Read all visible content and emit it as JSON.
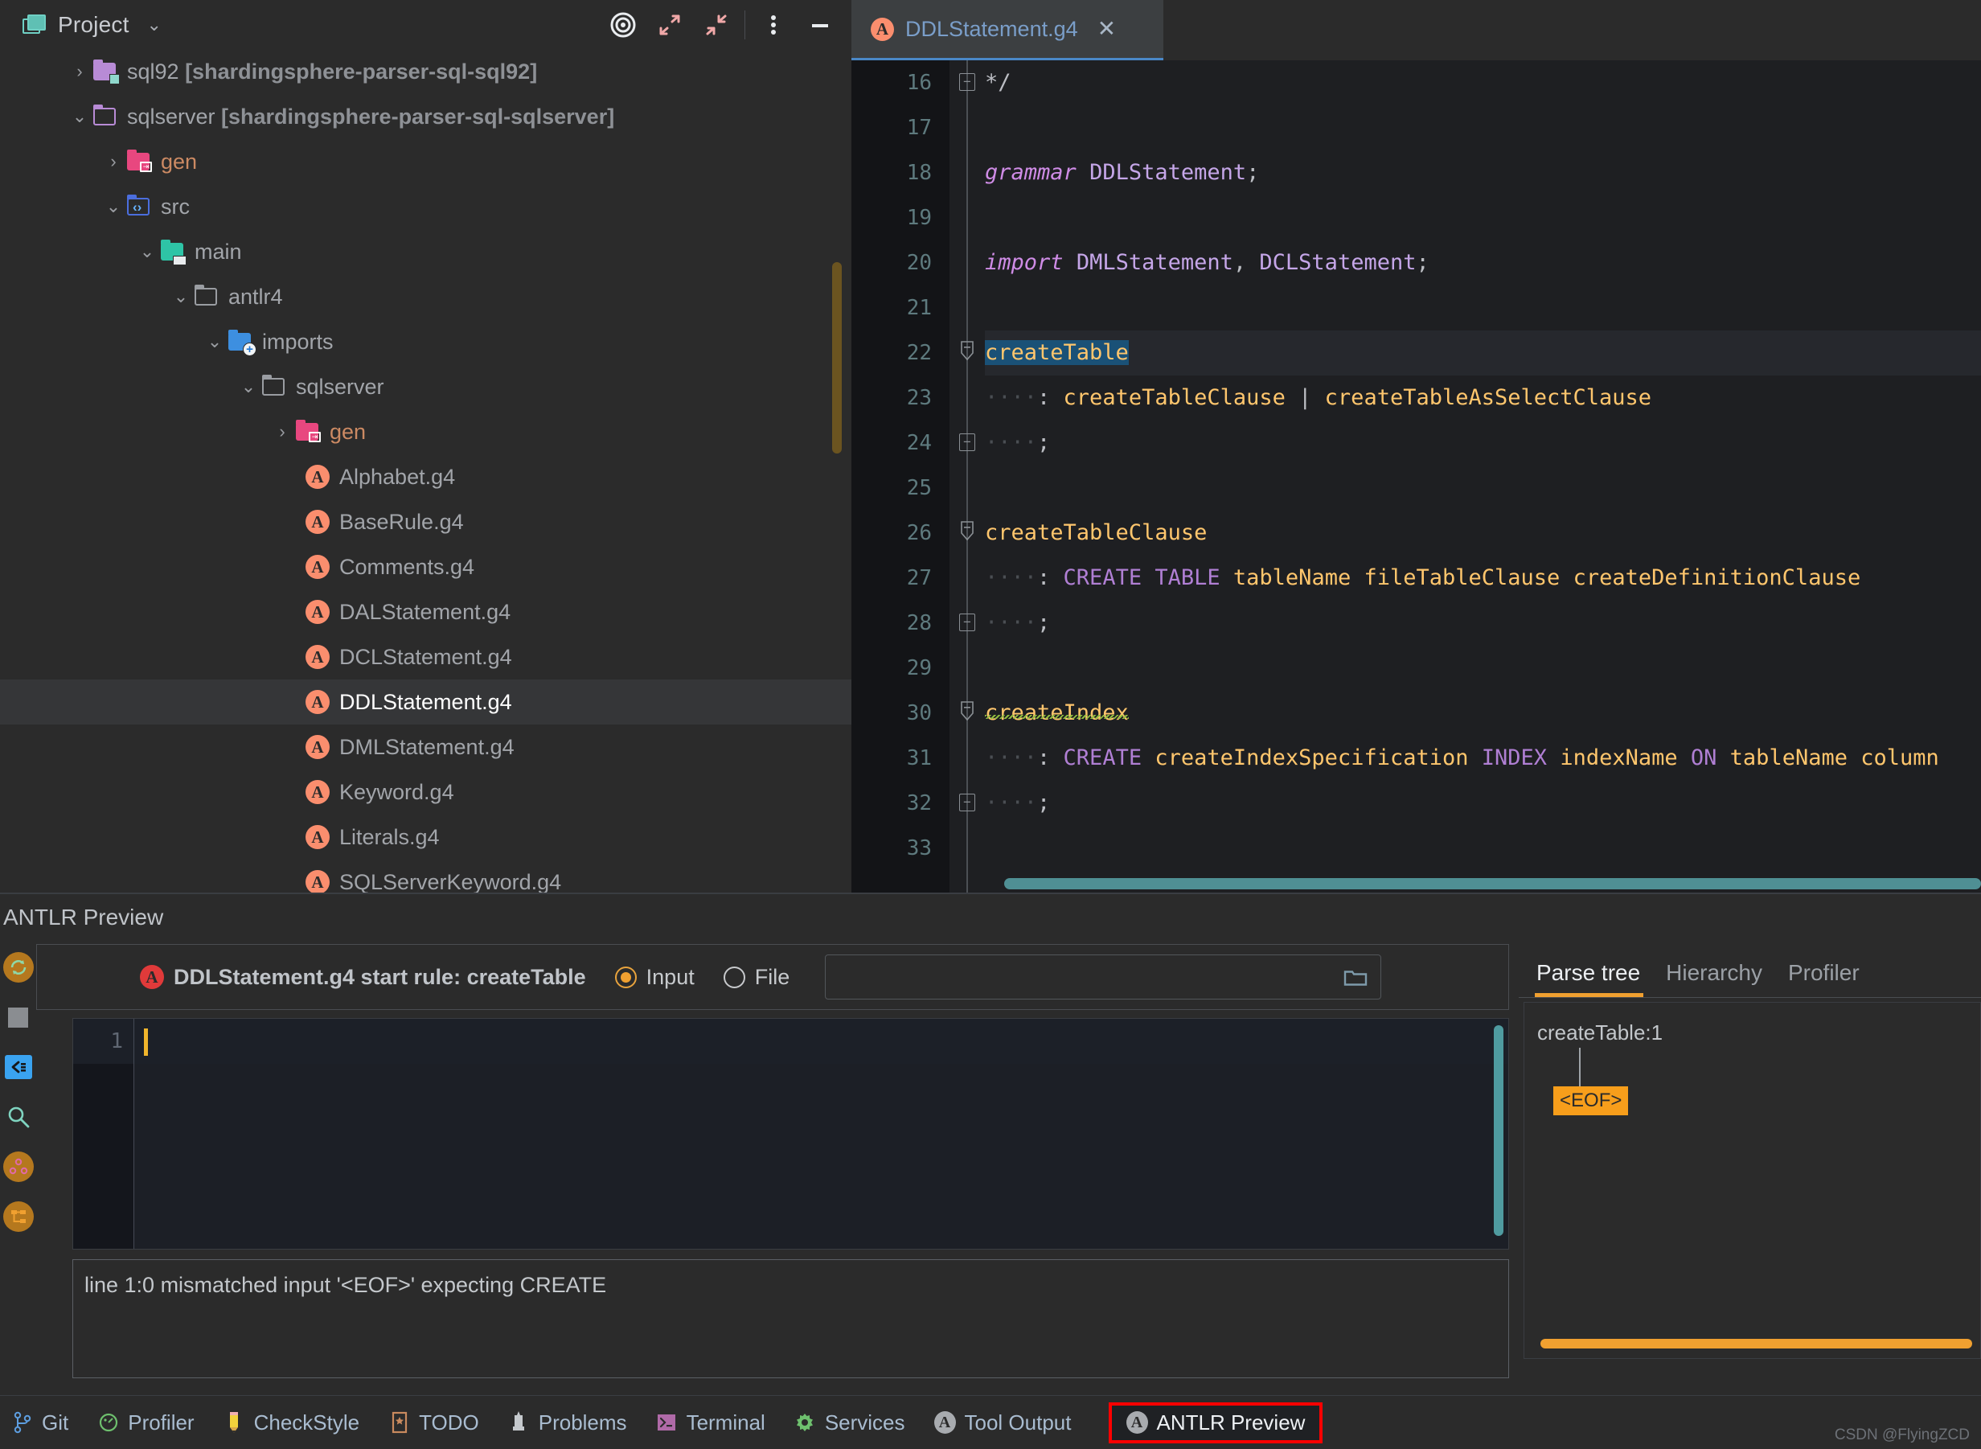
{
  "project": {
    "title": "Project",
    "chevron": "⌄",
    "toolbar": [
      {
        "name": "select-opened-file-icon",
        "glyph": "target"
      },
      {
        "name": "expand-all-icon",
        "glyph": "expand"
      },
      {
        "name": "collapse-all-icon",
        "glyph": "collapse"
      },
      {
        "name": "more-options-icon",
        "glyph": "dots"
      },
      {
        "name": "hide-panel-icon",
        "glyph": "minus"
      }
    ],
    "tree": [
      {
        "label": "sql92 ",
        "module": "[shardingsphere-parser-sql-sql92]",
        "arrow": "›",
        "indent": 84,
        "icon": "folder-purple-module",
        "selected": false
      },
      {
        "label": "sqlserver ",
        "module": "[shardingsphere-parser-sql-sqlserver]",
        "arrow": "⌄",
        "indent": 84,
        "icon": "folder-purple-outline",
        "selected": false
      },
      {
        "label": "gen",
        "module": "",
        "arrow": "›",
        "indent": 126,
        "icon": "folder-pink-gen",
        "selected": false
      },
      {
        "label": "src",
        "module": "",
        "arrow": "⌄",
        "indent": 126,
        "icon": "folder-src",
        "selected": false
      },
      {
        "label": "main",
        "module": "",
        "arrow": "⌄",
        "indent": 168,
        "icon": "folder-main",
        "selected": false
      },
      {
        "label": "antlr4",
        "module": "",
        "arrow": "⌄",
        "indent": 210,
        "icon": "folder-gray",
        "selected": false
      },
      {
        "label": "imports",
        "module": "",
        "arrow": "⌄",
        "indent": 252,
        "icon": "folder-imports",
        "selected": false
      },
      {
        "label": "sqlserver",
        "module": "",
        "arrow": "⌄",
        "indent": 294,
        "icon": "folder-gray",
        "selected": false
      },
      {
        "label": "gen",
        "module": "",
        "arrow": "›",
        "indent": 336,
        "icon": "folder-pink-gen",
        "selected": false
      },
      {
        "label": "Alphabet.g4",
        "module": "",
        "arrow": "",
        "indent": 348,
        "icon": "antlr-file",
        "selected": false
      },
      {
        "label": "BaseRule.g4",
        "module": "",
        "arrow": "",
        "indent": 348,
        "icon": "antlr-file",
        "selected": false
      },
      {
        "label": "Comments.g4",
        "module": "",
        "arrow": "",
        "indent": 348,
        "icon": "antlr-file",
        "selected": false
      },
      {
        "label": "DALStatement.g4",
        "module": "",
        "arrow": "",
        "indent": 348,
        "icon": "antlr-file",
        "selected": false
      },
      {
        "label": "DCLStatement.g4",
        "module": "",
        "arrow": "",
        "indent": 348,
        "icon": "antlr-file",
        "selected": false
      },
      {
        "label": "DDLStatement.g4",
        "module": "",
        "arrow": "",
        "indent": 348,
        "icon": "antlr-file",
        "selected": true
      },
      {
        "label": "DMLStatement.g4",
        "module": "",
        "arrow": "",
        "indent": 348,
        "icon": "antlr-file",
        "selected": false
      },
      {
        "label": "Keyword.g4",
        "module": "",
        "arrow": "",
        "indent": 348,
        "icon": "antlr-file",
        "selected": false
      },
      {
        "label": "Literals.g4",
        "module": "",
        "arrow": "",
        "indent": 348,
        "icon": "antlr-file",
        "selected": false
      },
      {
        "label": "SQLServerKeyword.g4",
        "module": "",
        "arrow": "",
        "indent": 348,
        "icon": "antlr-file",
        "selected": false
      }
    ]
  },
  "editor": {
    "tab_label": "DDLStatement.g4",
    "tab_close": "✕",
    "line_numbers": [
      "16",
      "17",
      "18",
      "19",
      "20",
      "21",
      "22",
      "23",
      "24",
      "25",
      "26",
      "27",
      "28",
      "29",
      "30",
      "31",
      "32",
      "33"
    ],
    "code_lines": [
      {
        "n": "16",
        "tokens": [
          {
            "t": "*/",
            "c": "punc"
          }
        ]
      },
      {
        "n": "17",
        "tokens": []
      },
      {
        "n": "18",
        "tokens": [
          {
            "t": "grammar",
            "c": "kw"
          },
          {
            "t": " ",
            "c": "punc"
          },
          {
            "t": "DDLStatement",
            "c": "idn"
          },
          {
            "t": ";",
            "c": "punc"
          }
        ]
      },
      {
        "n": "19",
        "tokens": []
      },
      {
        "n": "20",
        "tokens": [
          {
            "t": "import",
            "c": "kw"
          },
          {
            "t": " ",
            "c": "punc"
          },
          {
            "t": "DMLStatement",
            "c": "idn"
          },
          {
            "t": ", ",
            "c": "punc"
          },
          {
            "t": "DCLStatement",
            "c": "idn"
          },
          {
            "t": ";",
            "c": "punc"
          }
        ]
      },
      {
        "n": "21",
        "tokens": []
      },
      {
        "n": "22",
        "tokens": [
          {
            "t": "createTable",
            "c": "sel-blue"
          }
        ]
      },
      {
        "n": "23",
        "tokens": [
          {
            "t": "····",
            "c": "dots"
          },
          {
            "t": ": ",
            "c": "punc"
          },
          {
            "t": "createTableClause",
            "c": "rule"
          },
          {
            "t": " | ",
            "c": "punc"
          },
          {
            "t": "createTableAsSelectClause",
            "c": "rule"
          }
        ]
      },
      {
        "n": "24",
        "tokens": [
          {
            "t": "····",
            "c": "dots"
          },
          {
            "t": ";",
            "c": "punc"
          }
        ]
      },
      {
        "n": "25",
        "tokens": []
      },
      {
        "n": "26",
        "tokens": [
          {
            "t": "createTableClause",
            "c": "rule"
          }
        ]
      },
      {
        "n": "27",
        "tokens": [
          {
            "t": "····",
            "c": "dots"
          },
          {
            "t": ": ",
            "c": "punc"
          },
          {
            "t": "CREATE",
            "c": "kw2"
          },
          {
            "t": " ",
            "c": "punc"
          },
          {
            "t": "TABLE",
            "c": "kw2"
          },
          {
            "t": " ",
            "c": "punc"
          },
          {
            "t": "tableName",
            "c": "rule"
          },
          {
            "t": " ",
            "c": "punc"
          },
          {
            "t": "fileTableClause",
            "c": "rule"
          },
          {
            "t": " ",
            "c": "punc"
          },
          {
            "t": "createDefinitionClause",
            "c": "rule"
          }
        ]
      },
      {
        "n": "28",
        "tokens": [
          {
            "t": "····",
            "c": "dots"
          },
          {
            "t": ";",
            "c": "punc"
          }
        ]
      },
      {
        "n": "29",
        "tokens": []
      },
      {
        "n": "30",
        "tokens": [
          {
            "t": "createIndex",
            "c": "rule squig"
          }
        ]
      },
      {
        "n": "31",
        "tokens": [
          {
            "t": "····",
            "c": "dots"
          },
          {
            "t": ": ",
            "c": "punc"
          },
          {
            "t": "CREATE",
            "c": "kw2"
          },
          {
            "t": " ",
            "c": "punc"
          },
          {
            "t": "createIndexSpecification",
            "c": "rule"
          },
          {
            "t": " ",
            "c": "punc"
          },
          {
            "t": "INDEX",
            "c": "kw2"
          },
          {
            "t": " ",
            "c": "punc"
          },
          {
            "t": "indexName",
            "c": "rule"
          },
          {
            "t": " ",
            "c": "punc"
          },
          {
            "t": "ON",
            "c": "kw2"
          },
          {
            "t": " ",
            "c": "punc"
          },
          {
            "t": "tableName",
            "c": "rule"
          },
          {
            "t": " ",
            "c": "punc"
          },
          {
            "t": "column",
            "c": "rule"
          }
        ]
      },
      {
        "n": "32",
        "tokens": [
          {
            "t": "····",
            "c": "dots"
          },
          {
            "t": ";",
            "c": "punc"
          }
        ]
      },
      {
        "n": "33",
        "tokens": []
      }
    ]
  },
  "preview": {
    "title": "ANTLR Preview",
    "grammar_label": "DDLStatement.g4 start rule: createTable",
    "input_radio_label": "Input",
    "file_radio_label": "File",
    "input_selected": true,
    "file_path_value": "",
    "input_line_number": "1",
    "input_text": "",
    "error_message": "line 1:0 mismatched input '<EOF>' expecting CREATE",
    "side_icons": [
      {
        "name": "refresh-icon"
      },
      {
        "name": "stop-icon"
      },
      {
        "name": "scroll-to-end-icon"
      },
      {
        "name": "search-icon"
      },
      {
        "name": "graph-icon"
      },
      {
        "name": "tree-icon"
      }
    ],
    "right_tabs": [
      {
        "label": "Parse tree",
        "active": true
      },
      {
        "label": "Hierarchy",
        "active": false
      },
      {
        "label": "Profiler",
        "active": false
      }
    ],
    "parse_tree": {
      "root_label": "createTable:1",
      "child_label": "<EOF>"
    }
  },
  "status_bar": {
    "items": [
      {
        "label": "Git",
        "icon": "git-branch-icon",
        "highlighted": false
      },
      {
        "label": "Profiler",
        "icon": "profiler-icon",
        "highlighted": false
      },
      {
        "label": "CheckStyle",
        "icon": "checkstyle-pencil-icon",
        "highlighted": false
      },
      {
        "label": "TODO",
        "icon": "todo-icon",
        "highlighted": false
      },
      {
        "label": "Problems",
        "icon": "problems-icon",
        "highlighted": false
      },
      {
        "label": "Terminal",
        "icon": "terminal-icon",
        "highlighted": false
      },
      {
        "label": "Services",
        "icon": "services-gear-icon",
        "highlighted": false
      },
      {
        "label": "Tool Output",
        "icon": "antlr-gray-icon",
        "highlighted": false
      },
      {
        "label": "ANTLR Preview",
        "icon": "antlr-gray-icon",
        "highlighted": true
      }
    ],
    "watermark": "CSDN @FlyingZCD"
  },
  "colors": {
    "accent_orange": "#f0a030",
    "selection_blue": "#1a5177",
    "rule_yellow": "#ffc66d",
    "keyword_purple": "#cf8ce6",
    "highlight_red": "#ff0000",
    "tab_underline": "#4a88c7"
  }
}
